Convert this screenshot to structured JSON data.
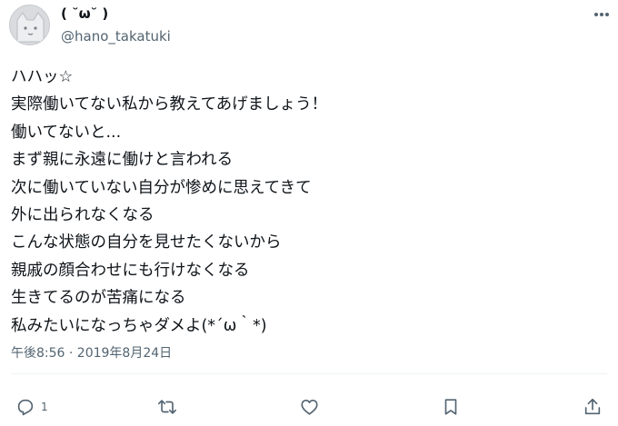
{
  "author": {
    "display_name": "( ˘ω˘ )",
    "handle": "@hano_takatuki",
    "avatar_icon": "cat-face-avatar-icon"
  },
  "tweet": {
    "lines": [
      "ハハッ☆",
      "実際働いてない私から教えてあげましょう！",
      "働いてないと...",
      "まず親に永遠に働けと言われる",
      "次に働いていない自分が惨めに思えてきて",
      "外に出られなくなる",
      "こんな状態の自分を見せたくないから",
      "親戚の顔合わせにも行けなくなる",
      "生きてるのが苦痛になる",
      "私みたいになっちゃダメよ(*´ω｀*)"
    ],
    "timestamp": "午後8:56 · 2019年8月24日"
  },
  "actions": {
    "reply_count": "1",
    "icons": [
      "reply-icon",
      "retweet-icon",
      "like-icon",
      "bookmark-icon",
      "share-icon"
    ]
  },
  "colors": {
    "text": "#0f1419",
    "secondary": "#536471",
    "divider": "#eff3f4"
  }
}
